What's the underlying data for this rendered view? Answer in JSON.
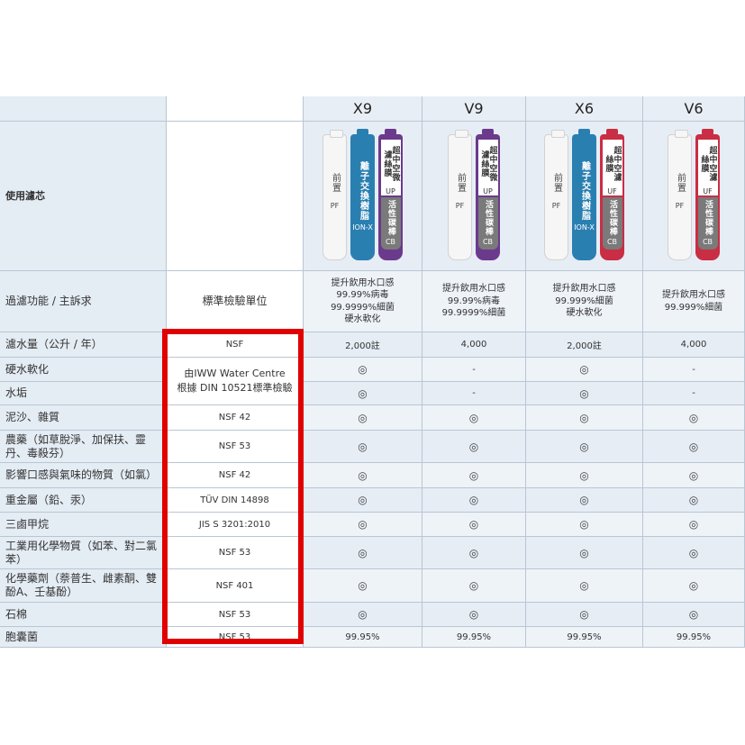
{
  "columns": {
    "feature_header": "",
    "standard_header": "標準檢驗單位",
    "products": [
      "X9",
      "V9",
      "X6",
      "V6"
    ]
  },
  "filters_row": {
    "label": "使用濾芯",
    "prefilter": {
      "text": "前置",
      "code": "PF"
    },
    "ion": {
      "text": "離子交換樹脂",
      "code": "ION-X"
    },
    "up": {
      "text": "超中空微濾絲膜",
      "code": "UP"
    },
    "uf": {
      "text": "超中空濾絲膜",
      "code": "UF"
    },
    "cb": {
      "text": "活性碳棒",
      "code": "CB"
    },
    "colors": {
      "ion": "#2a7fb1",
      "up": "#6b3a8c",
      "uf": "#c92e44",
      "cb": "#7a7a7a"
    }
  },
  "function_row": {
    "label": "過濾功能 / 主訴求",
    "standard": "標準檢驗單位",
    "X9": [
      "提升飲用水口感",
      "99.99%病毒",
      "99.9999%細菌",
      "硬水軟化"
    ],
    "V9": [
      "提升飲用水口感",
      "99.99%病毒",
      "99.9999%細菌"
    ],
    "X6": [
      "提升飲用水口感",
      "99.999%細菌",
      "硬水軟化"
    ],
    "V6": [
      "提升飲用水口感",
      "99.999%細菌"
    ]
  },
  "rows": [
    {
      "label": "濾水量（公升 / 年）",
      "standard": "NSF",
      "values": [
        "2,000註",
        "4,000",
        "2,000註",
        "4,000"
      ]
    },
    {
      "label": "硬水軟化",
      "standard": "",
      "values": [
        "◎",
        "-",
        "◎",
        "-"
      ]
    },
    {
      "label": "水垢",
      "standard": "",
      "values": [
        "◎",
        "-",
        "◎",
        "-"
      ]
    },
    {
      "label": "泥沙、雜質",
      "standard": "NSF 42",
      "values": [
        "◎",
        "◎",
        "◎",
        "◎"
      ]
    },
    {
      "label": "農藥（如草脫淨、加保扶、靈丹、毒殺芬）",
      "standard": "NSF 53",
      "values": [
        "◎",
        "◎",
        "◎",
        "◎"
      ]
    },
    {
      "label": "影響口感與氣味的物質（如氯）",
      "standard": "NSF 42",
      "values": [
        "◎",
        "◎",
        "◎",
        "◎"
      ]
    },
    {
      "label": "重金屬（鉛、汞）",
      "standard": "TÜV DIN 14898",
      "values": [
        "◎",
        "◎",
        "◎",
        "◎"
      ]
    },
    {
      "label": "三鹵甲烷",
      "standard": "JIS S 3201:2010",
      "values": [
        "◎",
        "◎",
        "◎",
        "◎"
      ]
    },
    {
      "label": "工業用化學物質（如苯、對二氯苯）",
      "standard": "NSF 53",
      "values": [
        "◎",
        "◎",
        "◎",
        "◎"
      ]
    },
    {
      "label": "化學藥劑（萘普生、雌素酮、雙酚A、壬基酚）",
      "standard": "NSF 401",
      "values": [
        "◎",
        "◎",
        "◎",
        "◎"
      ]
    },
    {
      "label": "石棉",
      "standard": "NSF 53",
      "values": [
        "◎",
        "◎",
        "◎",
        "◎"
      ]
    },
    {
      "label": "胞囊菌",
      "standard": "NSF 53",
      "values": [
        "99.95%",
        "99.95%",
        "99.95%",
        "99.95%"
      ]
    }
  ],
  "merged_standard": [
    "由IWW Water Centre",
    "根據 DIN 10521標準檢驗"
  ],
  "highlight_color": "#e00000"
}
